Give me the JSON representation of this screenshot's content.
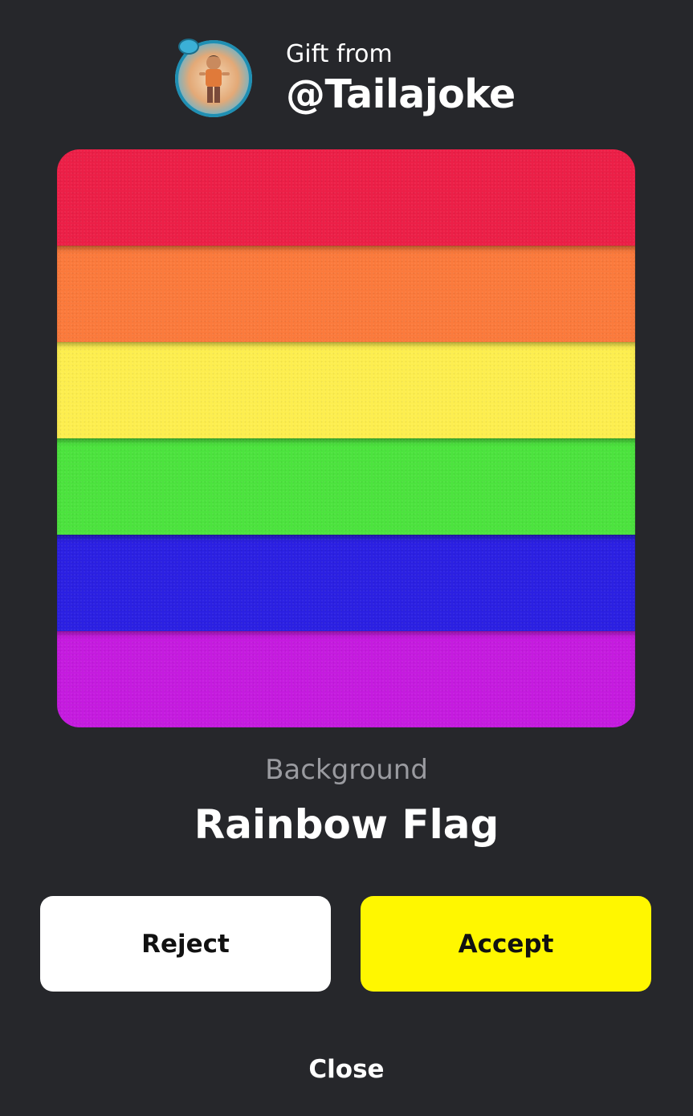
{
  "header": {
    "gift_from_label": "Gift from",
    "username": "@Tailajoke",
    "avatar_icon": "bitmoji-avatar"
  },
  "flag": {
    "stripe_colors": [
      "#ec1f47",
      "#fb7a3c",
      "#fdee4f",
      "#4ce33e",
      "#2b20e2",
      "#c51bdf"
    ]
  },
  "item": {
    "type": "Background",
    "name": "Rainbow Flag"
  },
  "buttons": {
    "reject_label": "Reject",
    "accept_label": "Accept",
    "reject_color": "#ffffff",
    "accept_color": "#fff700"
  },
  "close_label": "Close"
}
